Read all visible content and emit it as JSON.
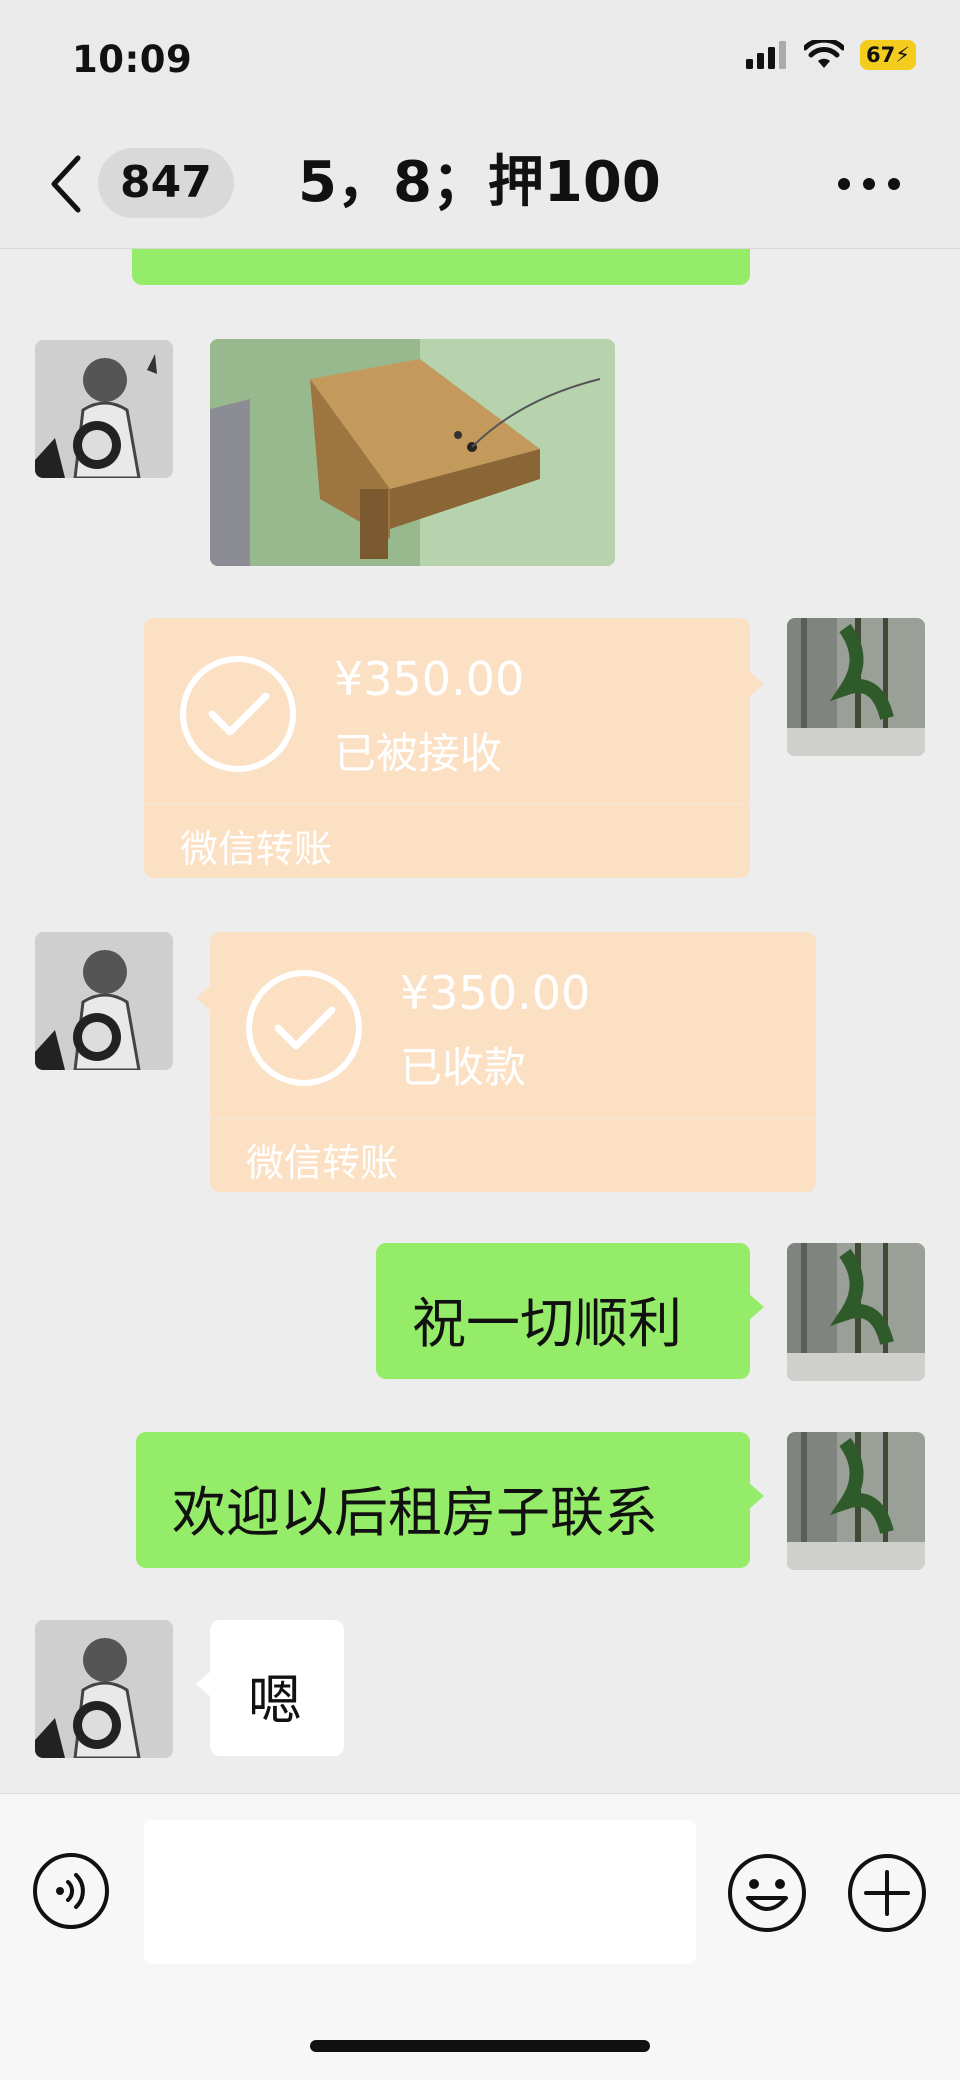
{
  "status_bar": {
    "time": "10:09",
    "battery": "67"
  },
  "header": {
    "unread_count": "847",
    "title": "5，8；押100"
  },
  "messages": [
    {
      "type": "image",
      "side": "left",
      "description": "photo"
    },
    {
      "type": "transfer",
      "side": "right",
      "amount": "¥350.00",
      "status": "已被接收",
      "footer": "微信转账"
    },
    {
      "type": "transfer",
      "side": "left",
      "amount": "¥350.00",
      "status": "已收款",
      "footer": "微信转账"
    },
    {
      "type": "text",
      "side": "right",
      "text": "祝一切顺利"
    },
    {
      "type": "text",
      "side": "right",
      "text": "欢迎以后租房子联系"
    },
    {
      "type": "text",
      "side": "left",
      "text": "嗯"
    }
  ],
  "input": {
    "value": "",
    "placeholder": ""
  },
  "icons": {
    "back": "chevron-left-icon",
    "more": "more-dots-icon",
    "voice": "voice-icon",
    "emoji": "emoji-icon",
    "plus": "plus-circle-icon",
    "transfer_status": "check-circle-icon"
  },
  "colors": {
    "bubble_green": "#95ec69",
    "bubble_white": "#ffffff",
    "transfer_bg": "#fbe0c4",
    "chat_bg": "#ededed",
    "battery": "#f4cc1e"
  }
}
